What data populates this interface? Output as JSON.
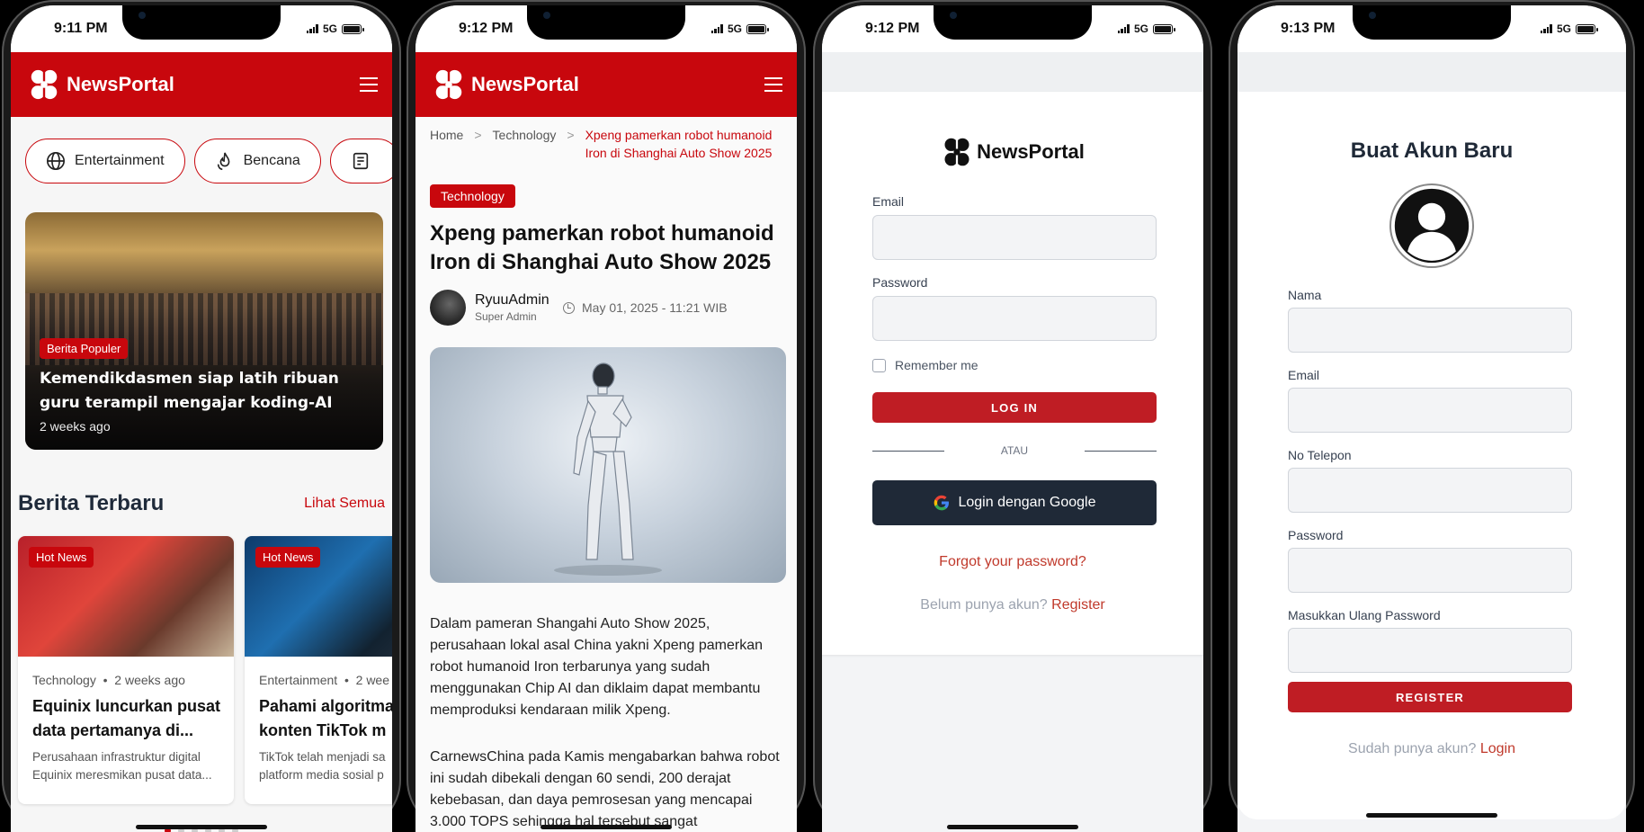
{
  "phones": [
    {
      "time": "9:11 PM",
      "network": "5G",
      "brand": "NewsPortal",
      "categories": [
        {
          "label": "Entertainment",
          "icon": "globe-icon"
        },
        {
          "label": "Bencana",
          "icon": "fire-icon"
        },
        {
          "label": "",
          "icon": "newspaper-icon"
        }
      ],
      "featured": {
        "badge": "Berita Populer",
        "title": "Kemendikdasmen siap latih ribuan guru terampil mengajar koding-AI",
        "time": "2 weeks ago"
      },
      "section": {
        "title": "Berita Terbaru",
        "link": "Lihat Semua"
      },
      "cards": [
        {
          "badge": "Hot News",
          "category": "Technology",
          "time": "2 weeks ago",
          "title": "Equinix luncurkan pusat data pertamanya di...",
          "desc_1": " Perusahaan infrastruktur digital",
          "desc_2": "Equinix meresmikan pusat data..."
        },
        {
          "badge": "Hot News",
          "category": "Entertainment",
          "time": "2 wee",
          "title": "Pahami algoritma konten TikTok m",
          "desc_1": "TikTok telah menjadi sa",
          "desc_2": "platform media sosial p"
        }
      ],
      "pagination": {
        "total": 6,
        "active": 0
      }
    },
    {
      "time": "9:12 PM",
      "network": "5G",
      "brand": "NewsPortal",
      "breadcrumb": {
        "home": "Home",
        "sep": ">",
        "category": "Technology",
        "current": "Xpeng pamerkan robot humanoid Iron di Shanghai Auto Show 2025"
      },
      "article": {
        "category": "Technology",
        "title": "Xpeng pamerkan robot humanoid Iron di Shanghai Auto Show 2025",
        "author": "RyuuAdmin",
        "role": "Super Admin",
        "date": "May 01, 2025 - 11:21 WIB",
        "p1": " Dalam pameran Shangahi Auto Show 2025, perusahaan lokal asal China yakni Xpeng pamerkan robot humanoid Iron terbarunya yang sudah menggunakan Chip AI dan diklaim dapat membantu memproduksi kendaraan milik Xpeng.",
        "p2": "CarnewsChina pada Kamis mengabarkan bahwa robot ini sudah dibekali dengan 60 sendi, 200 derajat kebebasan, dan daya pemrosesan yang mencapai 3.000 TOPS sehingga hal tersebut sangat mengagumkan."
      }
    },
    {
      "time": "9:12 PM",
      "network": "5G",
      "brand": "NewsPortal",
      "login": {
        "email_label": "Email",
        "password_label": "Password",
        "remember": "Remember me",
        "submit": "LOG IN",
        "or": "ATAU",
        "google": "Login dengan Google",
        "forgot": "Forgot your password?",
        "no_account": "Belum punya akun?",
        "register": "Register"
      }
    },
    {
      "time": "9:13 PM",
      "network": "5G",
      "register": {
        "title": "Buat Akun Baru",
        "name_label": "Nama",
        "email_label": "Email",
        "phone_label": "No Telepon",
        "password_label": "Password",
        "confirm_label": "Masukkan Ulang Password",
        "submit": "REGISTER",
        "have_account": "Sudah punya akun?",
        "login": "Login"
      }
    }
  ],
  "colors": {
    "brand_red": "#c8070d",
    "button_red": "#bf1d24",
    "dark_button": "#1f2937",
    "link_red": "#c0392b"
  }
}
